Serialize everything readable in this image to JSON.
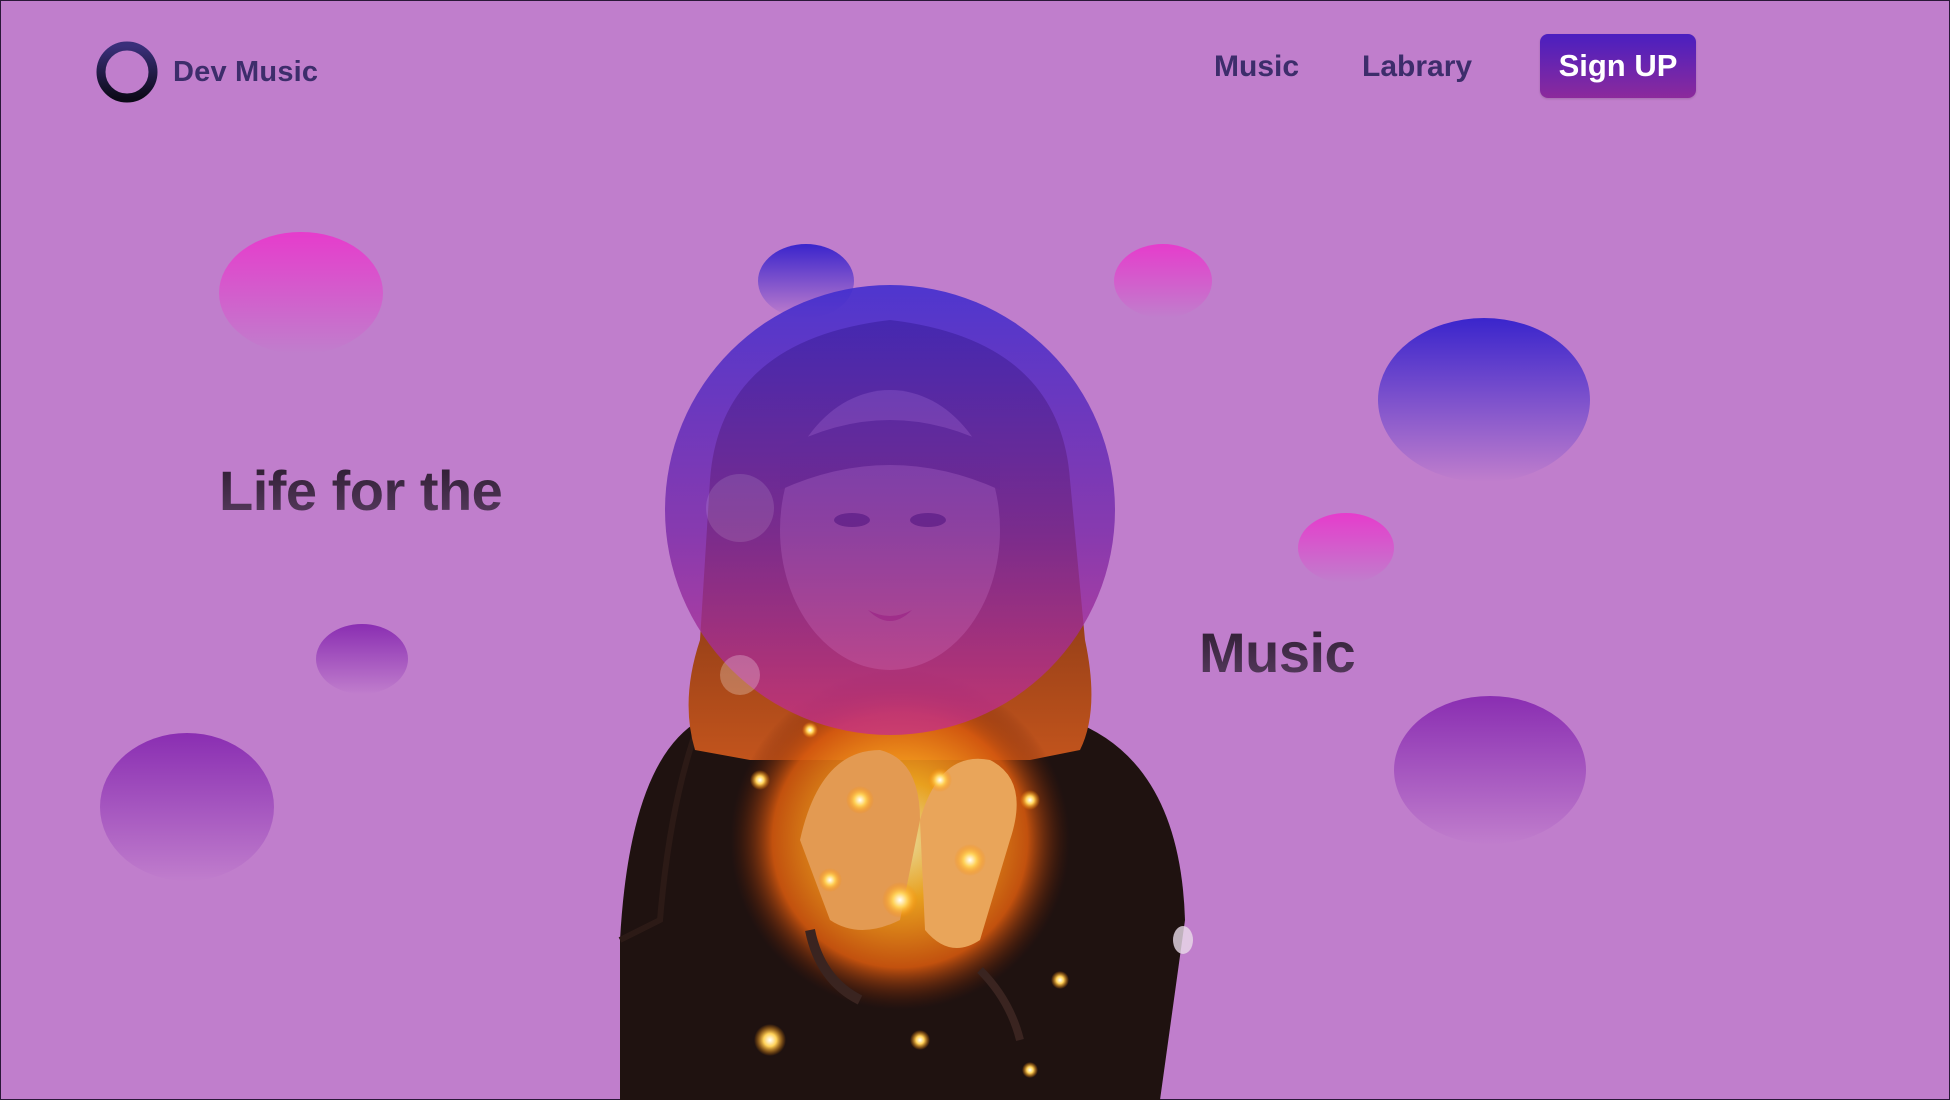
{
  "header": {
    "brand_name": "Dev Music",
    "nav": [
      {
        "label": "Music"
      },
      {
        "label": "Labrary"
      }
    ],
    "signup_label": "Sign UP"
  },
  "hero": {
    "line1": "Life for the",
    "line2": "Music"
  },
  "icons": {
    "logo": "ring-logo-icon"
  },
  "colors": {
    "background": "#c07ecc",
    "text_dark": "#3d2d6b",
    "button_top": "#4a1fc0",
    "button_bottom": "#8c2a9c",
    "bubble_pink": "#e63ccc",
    "bubble_blue": "#3a25cc",
    "bubble_violet": "#8a2eb2"
  }
}
